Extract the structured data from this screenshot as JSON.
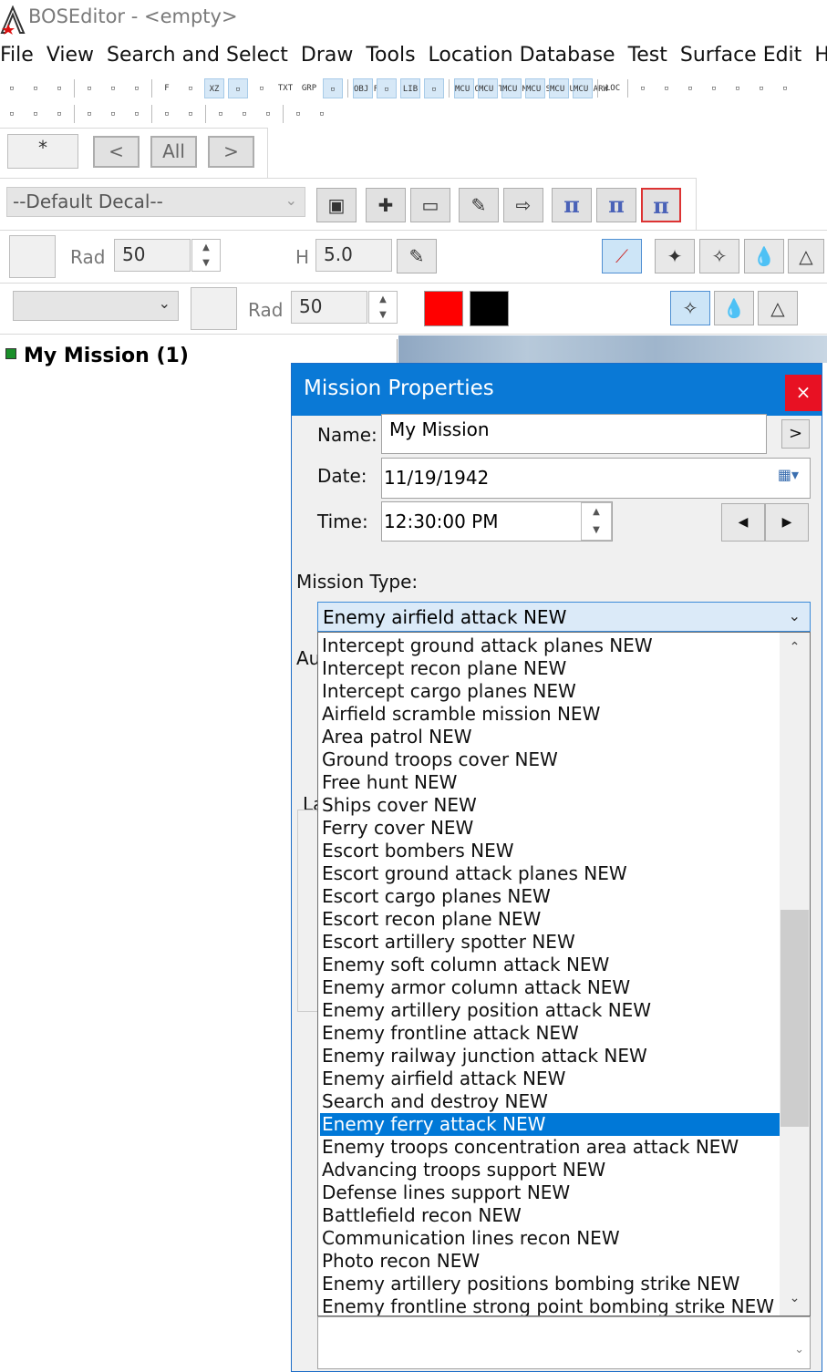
{
  "window": {
    "title": "BOSEditor - <empty>"
  },
  "menu": [
    "File",
    "View",
    "Search and Select",
    "Draw",
    "Tools",
    "Location Database",
    "Test",
    "Surface Edit",
    "Heig"
  ],
  "toolbar1": [
    "cut-icon",
    "copy-icon",
    "ruler-icon",
    "sep",
    "grid-green-icon",
    "grid-color-icon",
    "download-icon",
    "sep",
    "F",
    "ground-icon",
    "XZ",
    "hash-icon",
    "info-icon",
    "TXT",
    "GRP",
    "clock-icon",
    "sep",
    "OBJ FLT",
    "flag-icon",
    "LIB",
    "list-icon",
    "sep",
    "MCU OBJ",
    "MCU TAR",
    "MCU MES",
    "MCU SEL",
    "MCU UNSE",
    "MCU ARW",
    "sep",
    "LOC",
    "sep",
    "check-icon",
    "mail-icon",
    "dot-icon",
    "line1-icon",
    "line2-icon",
    "arrow-up-icon",
    "help-icon"
  ],
  "toolbar2": [
    "ico-a",
    "ico-b",
    "ico-c",
    "sep",
    "ico-d",
    "ico-e",
    "ico-f",
    "sep",
    "ico-g",
    "ico-h",
    "sep",
    "ico-i",
    "ico-j",
    "ico-k",
    "sep",
    "ico-l",
    "ico-m"
  ],
  "nav": {
    "star": "*",
    "prev": "<",
    "all": "All",
    "next": ">"
  },
  "decal": {
    "selected": "--Default Decal--"
  },
  "row1": {
    "rad_label": "Rad",
    "rad_value": "50",
    "h_label": "H",
    "h_value": "5.0"
  },
  "row2": {
    "rad_label": "Rad",
    "rad_value": "50",
    "color_a": "#ff0000",
    "color_b": "#000000"
  },
  "tree": {
    "root": "My Mission (1)"
  },
  "dialog": {
    "title": "Mission Properties",
    "close": "×",
    "name_label": "Name:",
    "name_value": "My Mission",
    "name_button": ">",
    "date_label": "Date:",
    "date_value": "11/19/1942",
    "time_label": "Time:",
    "time_value": "12:30:00 PM",
    "mission_type_label": "Mission Type:",
    "mission_type_value": "Enemy airfield attack NEW",
    "hidden_label_1": "Au",
    "hidden_label_2": "La"
  },
  "mission_types": [
    "Intercept ground attack planes NEW",
    "Intercept recon plane NEW",
    "Intercept cargo planes NEW",
    "Airfield scramble mission NEW",
    "Area patrol NEW",
    "Ground troops cover NEW",
    "Free hunt NEW",
    "Ships cover NEW",
    "Ferry cover NEW",
    "Escort bombers NEW",
    "Escort ground attack planes NEW",
    "Escort cargo planes NEW",
    "Escort recon plane NEW",
    "Escort artillery spotter NEW",
    "Enemy soft column attack NEW",
    "Enemy armor column attack NEW",
    "Enemy artillery position attack NEW",
    "Enemy frontline attack NEW",
    "Enemy railway junction attack NEW",
    "Enemy airfield attack NEW",
    "Search and destroy NEW",
    "Enemy ferry attack NEW",
    "Enemy troops concentration area attack NEW",
    "Advancing troops support NEW",
    "Defense lines support NEW",
    "Battlefield recon NEW",
    "Communication lines recon NEW",
    "Photo recon NEW",
    "Enemy artillery positions bombing strike NEW",
    "Enemy frontline strong point bombing strike NEW"
  ],
  "highlighted_mission_type": "Enemy ferry attack NEW"
}
